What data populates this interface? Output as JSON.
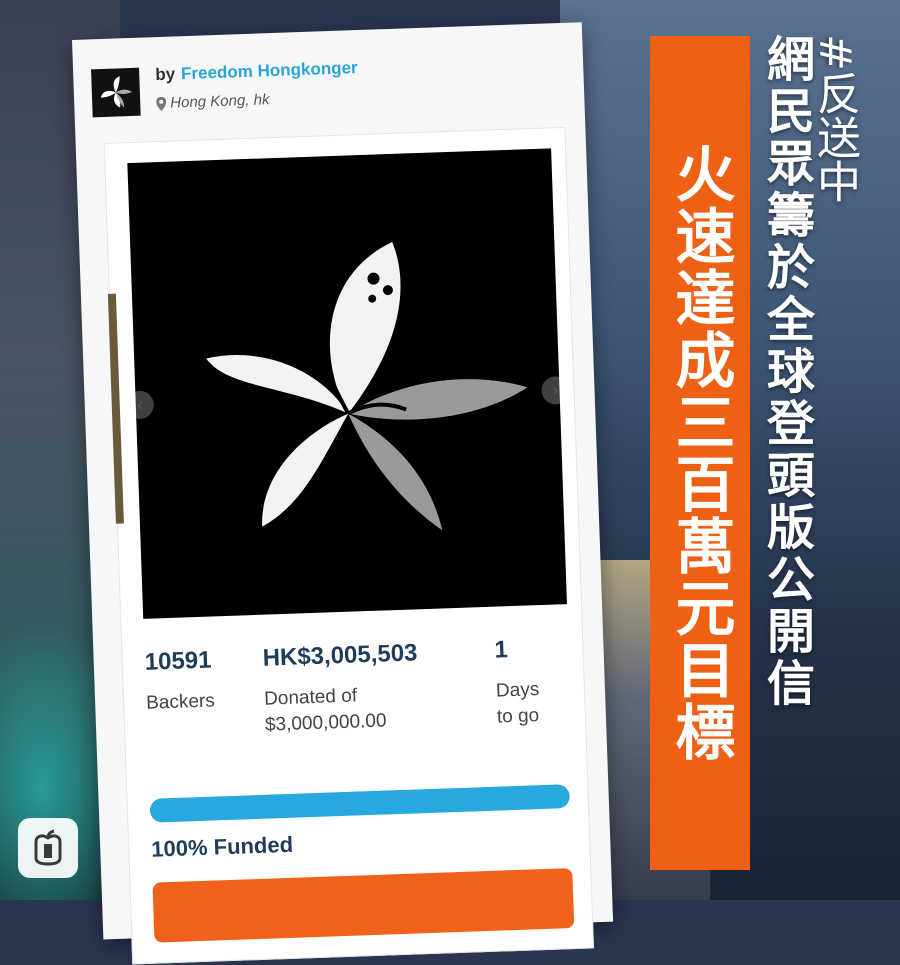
{
  "campaign": {
    "by_label": "by",
    "organizer_name": "Freedom Hongkonger",
    "location": "Hong Kong, hk"
  },
  "stats": {
    "backers_value": "10591",
    "backers_label": "Backers",
    "donated_value": "HK$3,005,503",
    "donated_label_line1": "Donated of",
    "donated_label_line2": "$3,000,000.00",
    "days_value": "1",
    "days_label_line1": "Days",
    "days_label_line2": "to go"
  },
  "progress": {
    "percent": 100,
    "label": "100% Funded"
  },
  "headline": {
    "main": "火速達成三百萬元目標",
    "hashtag": "#反送中",
    "sub": "網民眾籌於全球登頭版公開信"
  },
  "icons": {
    "avatar": "black-bauhinia-icon",
    "location": "map-pin-icon",
    "hero": "black-bauhinia-flower-image",
    "nav_left": "chevron-left-icon",
    "nav_right": "chevron-right-icon",
    "brand": "apple-daily-logo-icon"
  },
  "colors": {
    "accent_orange": "#ee6014",
    "link_blue": "#2aa3d6",
    "progress_blue": "#27a9df",
    "stat_navy": "#1f3c5a"
  }
}
